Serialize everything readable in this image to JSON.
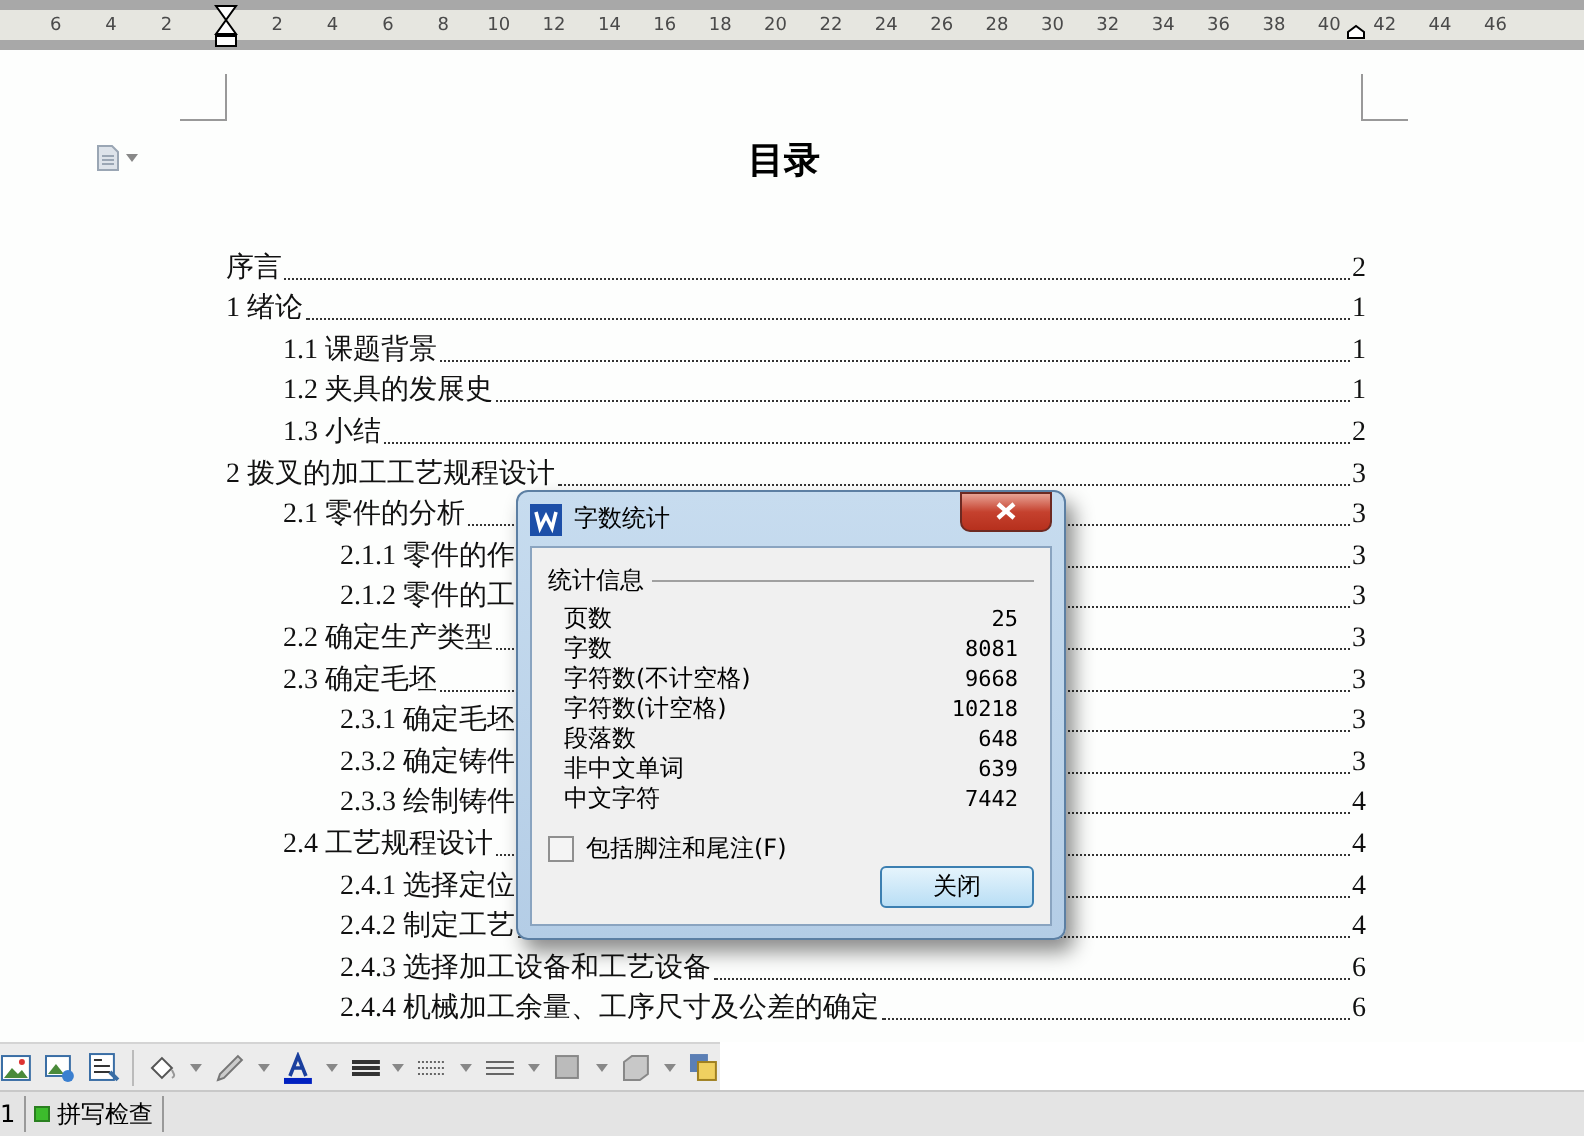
{
  "ruler": {
    "left_labels": [
      "6",
      "4",
      "2"
    ],
    "right_labels": [
      "2",
      "4",
      "6",
      "8",
      "10",
      "12",
      "14",
      "16",
      "18",
      "20",
      "22",
      "24",
      "26",
      "28",
      "30",
      "32",
      "34",
      "36",
      "38",
      "40",
      "42",
      "44",
      "46"
    ]
  },
  "document": {
    "title": "目录",
    "toc": [
      {
        "title": "序言",
        "page": "2"
      },
      {
        "title": "1 绪论",
        "page": "1",
        "children": [
          {
            "title": "1.1 课题背景",
            "page": "1"
          },
          {
            "title": "1.2 夹具的发展史",
            "page": "1"
          },
          {
            "title": "1.3 小结",
            "page": "2"
          }
        ]
      },
      {
        "title": "2 拨叉的加工工艺规程设计",
        "page": "3",
        "children": [
          {
            "title": "2.1 零件的分析",
            "page": "3",
            "children": [
              {
                "title": "2.1.1 零件的作",
                "page": "3"
              },
              {
                "title": "2.1.2 零件的工",
                "page": "3"
              }
            ]
          },
          {
            "title": "2.2 确定生产类型",
            "page": "3"
          },
          {
            "title": "2.3 确定毛坯",
            "page": "3",
            "children": [
              {
                "title": "2.3.1 确定毛坯",
                "page": "3"
              },
              {
                "title": "2.3.2 确定铸件",
                "page": "3"
              },
              {
                "title": "2.3.3 绘制铸件",
                "page": "4"
              }
            ]
          },
          {
            "title": "2.4 工艺规程设计",
            "page": "4",
            "children": [
              {
                "title": "2.4.1 选择定位",
                "page": "4"
              },
              {
                "title": "2.4.2 制定工艺",
                "page": "4"
              },
              {
                "title": "2.4.3 选择加工设备和工艺设备",
                "page": "6"
              },
              {
                "title": "2.4.4 机械加工余量、工序尺寸及公差的确定",
                "page": "6"
              }
            ]
          }
        ]
      }
    ]
  },
  "dialog": {
    "title": "字数统计",
    "group": "统计信息",
    "stats": [
      {
        "label": "页数",
        "value": "25"
      },
      {
        "label": "字数",
        "value": "8081"
      },
      {
        "label": "字符数(不计空格)",
        "value": "9668"
      },
      {
        "label": "字符数(计空格)",
        "value": "10218"
      },
      {
        "label": "段落数",
        "value": "648"
      },
      {
        "label": "非中文单词",
        "value": "639"
      },
      {
        "label": "中文字符",
        "value": "7442"
      }
    ],
    "checkbox": {
      "label": "包括脚注和尾注(F)",
      "checked": false
    },
    "button": "关闭"
  },
  "status_bar": {
    "page": "1",
    "spell_check": "拼写检查"
  }
}
